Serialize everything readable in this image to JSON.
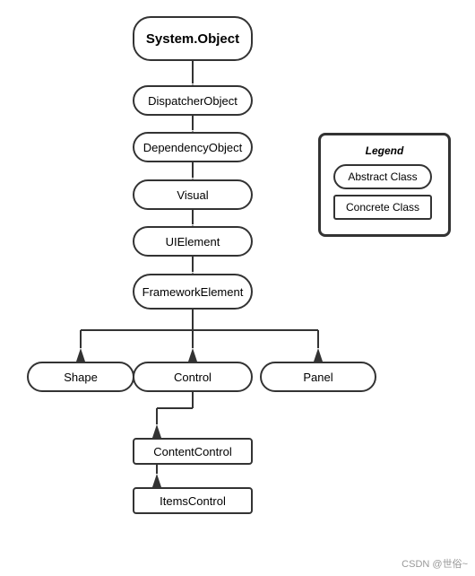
{
  "nodes": {
    "systemObject": {
      "label": "System.Object",
      "type": "abstract",
      "bold": true
    },
    "dispatcherObject": {
      "label": "DispatcherObject",
      "type": "abstract"
    },
    "dependencyObject": {
      "label": "DependencyObject",
      "type": "abstract"
    },
    "visual": {
      "label": "Visual",
      "type": "abstract"
    },
    "uiElement": {
      "label": "UIElement",
      "type": "abstract"
    },
    "frameworkElement": {
      "label": "FrameworkElement",
      "type": "abstract"
    },
    "shape": {
      "label": "Shape",
      "type": "abstract"
    },
    "control": {
      "label": "Control",
      "type": "abstract"
    },
    "panel": {
      "label": "Panel",
      "type": "abstract"
    },
    "contentControl": {
      "label": "ContentControl",
      "type": "concrete"
    },
    "itemsControl": {
      "label": "ItemsControl",
      "type": "concrete"
    }
  },
  "legend": {
    "title": "Legend",
    "abstractLabel": "Abstract Class",
    "concreteLabel": "Concrete Class"
  },
  "watermark": "CSDN @世俗~"
}
